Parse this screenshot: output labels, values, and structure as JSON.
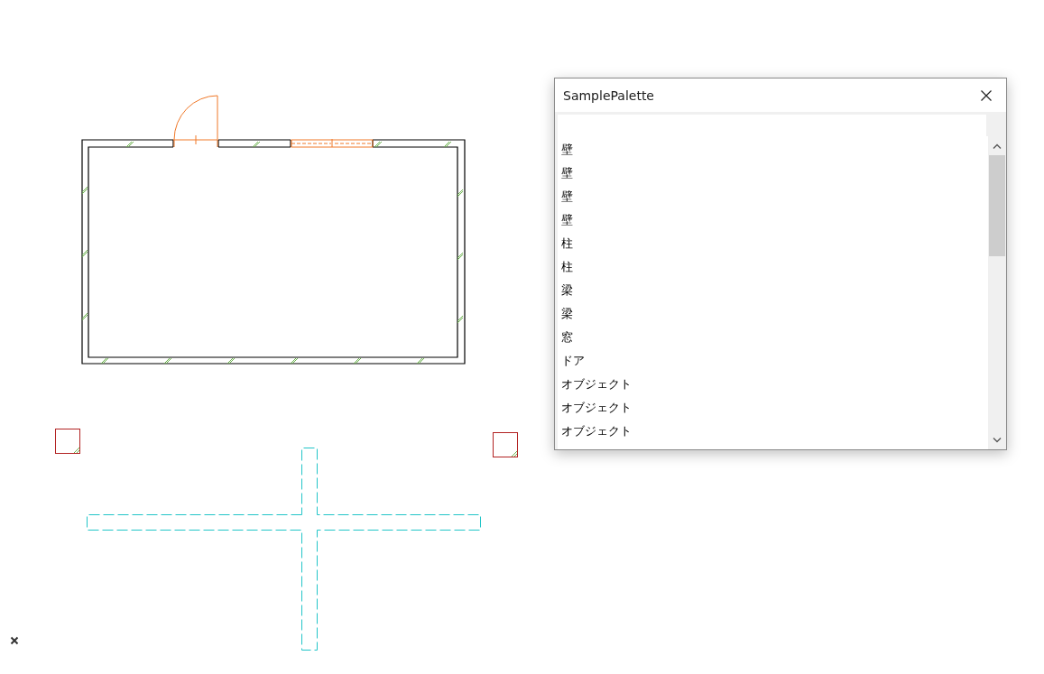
{
  "palette": {
    "title": "SamplePalette",
    "items": [
      "壁",
      "壁",
      "壁",
      "壁",
      "柱",
      "柱",
      "梁",
      "梁",
      "窓",
      "ドア",
      "オブジェクト",
      "オブジェクト",
      "オブジェクト"
    ]
  }
}
